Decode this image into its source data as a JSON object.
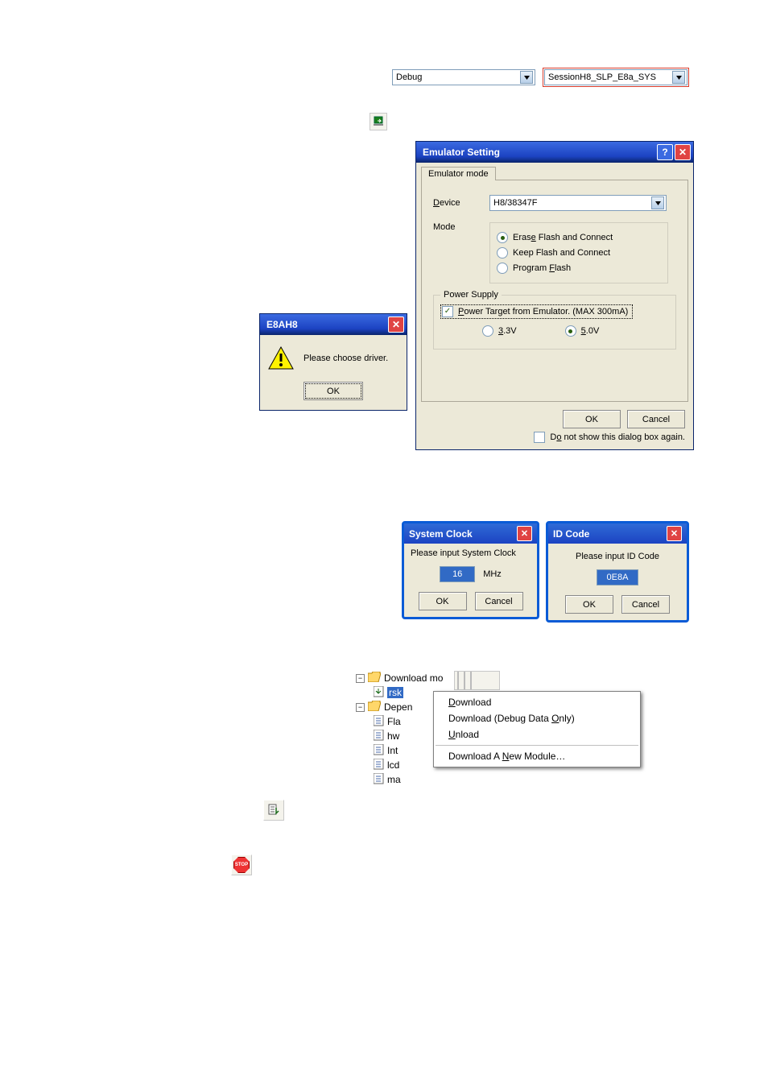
{
  "toolbar": {
    "build_config": "Debug",
    "session": "SessionH8_SLP_E8a_SYS"
  },
  "e8ah8_dlg": {
    "title": "E8AH8",
    "message": "Please choose driver.",
    "ok": "OK"
  },
  "emulator_dlg": {
    "title": "Emulator Setting",
    "tab": "Emulator mode",
    "device_label": "Device",
    "device_value": "H8/38347F",
    "mode_label": "Mode",
    "radio_erase": "Erase Flash and Connect",
    "radio_keep": "Keep Flash and Connect",
    "radio_prog": "Program Flash",
    "power_group": "Power Supply",
    "power_check": "Power Target from Emulator. (MAX 300mA)",
    "v33": "3.3V",
    "v50": "5.0V",
    "ok": "OK",
    "cancel": "Cancel",
    "dontshow": "Do not show this dialog box again."
  },
  "sysclock_dlg": {
    "title": "System Clock",
    "prompt": "Please input System Clock",
    "value": "16",
    "unit": "MHz",
    "ok": "OK",
    "cancel": "Cancel"
  },
  "idcode_dlg": {
    "title": "ID Code",
    "prompt": "Please input ID Code",
    "value": "0E8A",
    "ok": "OK",
    "cancel": "Cancel"
  },
  "tree": {
    "download_mod": "Download mo",
    "rsk_item": "rsk",
    "depen": "Depen",
    "items": [
      "Fla",
      "hw",
      "Int",
      "lcd",
      "ma"
    ]
  },
  "context_menu": {
    "download": "Download",
    "download_debug": "Download (Debug Data Only)",
    "unload": "Unload",
    "download_new": "Download A New Module…"
  },
  "stop_label": "STOP"
}
